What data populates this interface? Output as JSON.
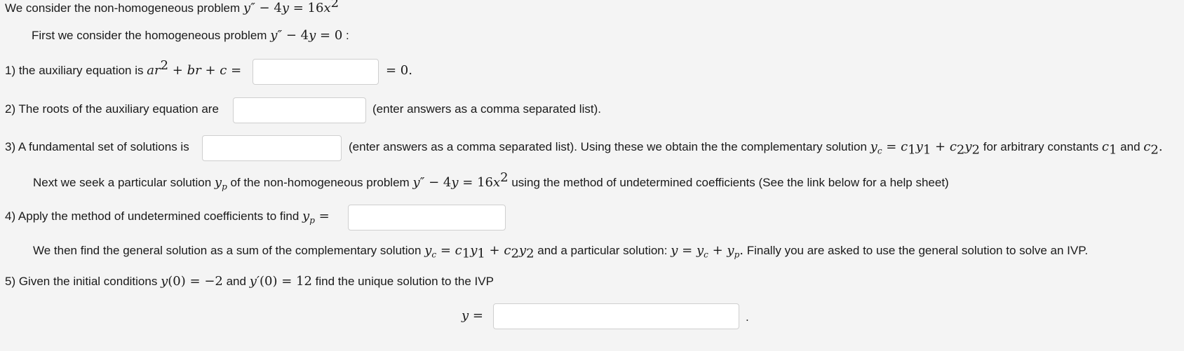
{
  "intro": {
    "text": "We consider the non-homogeneous problem",
    "eq": "y″ − 4y = 16x²"
  },
  "homog": {
    "text": "First we consider the homogeneous problem",
    "eq": "y″ − 4y = 0",
    "colon": ":"
  },
  "q1": {
    "text": "1) the auxiliary equation is",
    "eq": "ar² + br + c =",
    "answer": "",
    "after": "= 0."
  },
  "q2": {
    "text": "2) The roots of the auxiliary equation are",
    "answer": "",
    "after": "(enter answers as a comma separated list)."
  },
  "q3": {
    "text": "3) A fundamental set of solutions is",
    "answer": "",
    "after": "(enter answers as a comma separated list). Using these we obtain the the complementary solution",
    "yc_eq": "yc = c1y1 + c2y2",
    "arbitrary": "for arbitrary constants",
    "c1": "c1",
    "and": "and",
    "c2": "c2."
  },
  "next": {
    "text1": "Next we seek a particular solution",
    "yp": "yp",
    "text2": "of the non-homogeneous problem",
    "eq": "y″ − 4y = 16x²",
    "text3": "using the method of undetermined coefficients (See the link below for a help sheet)"
  },
  "q4": {
    "text": "4) Apply the method of undetermined coefficients to find",
    "eq": "yp =",
    "answer": ""
  },
  "general": {
    "text1": "We then find the general solution as a sum of the complementary solution",
    "yc_eq": "yc = c1y1 + c2y2",
    "text2": "and a particular solution:",
    "y_eq": "y = yc + yp.",
    "text3": "Finally you are asked to use the general solution to solve an IVP."
  },
  "q5": {
    "text1": "5) Given the initial conditions",
    "ic1": "y(0) = −2",
    "and": "and",
    "ic2": "y′(0) = 12",
    "text2": "find the unique solution to the IVP",
    "y_label": "y =",
    "answer": "",
    "period": "."
  }
}
